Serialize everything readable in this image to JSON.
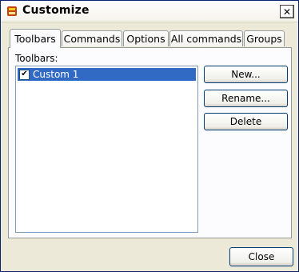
{
  "window": {
    "title": "Customize",
    "close_glyph": "✕"
  },
  "tabs": [
    {
      "label": "Toolbars",
      "active": true
    },
    {
      "label": "Commands",
      "active": false
    },
    {
      "label": "Options",
      "active": false
    },
    {
      "label": "All commands",
      "active": false
    },
    {
      "label": "Groups",
      "active": false
    }
  ],
  "toolbars": {
    "list_label": "Toolbars:",
    "items": [
      {
        "label": "Custom 1",
        "checked": true,
        "selected": true
      }
    ],
    "check_glyph": "✔",
    "buttons": {
      "new": "New...",
      "rename": "Rename...",
      "delete": "Delete"
    }
  },
  "footer": {
    "close_label": "Close"
  },
  "colors": {
    "selection": "#316ac5",
    "dialog_bg": "#ece9d8",
    "panel_bg": "#fcfcfe",
    "button_border": "#003c74"
  }
}
